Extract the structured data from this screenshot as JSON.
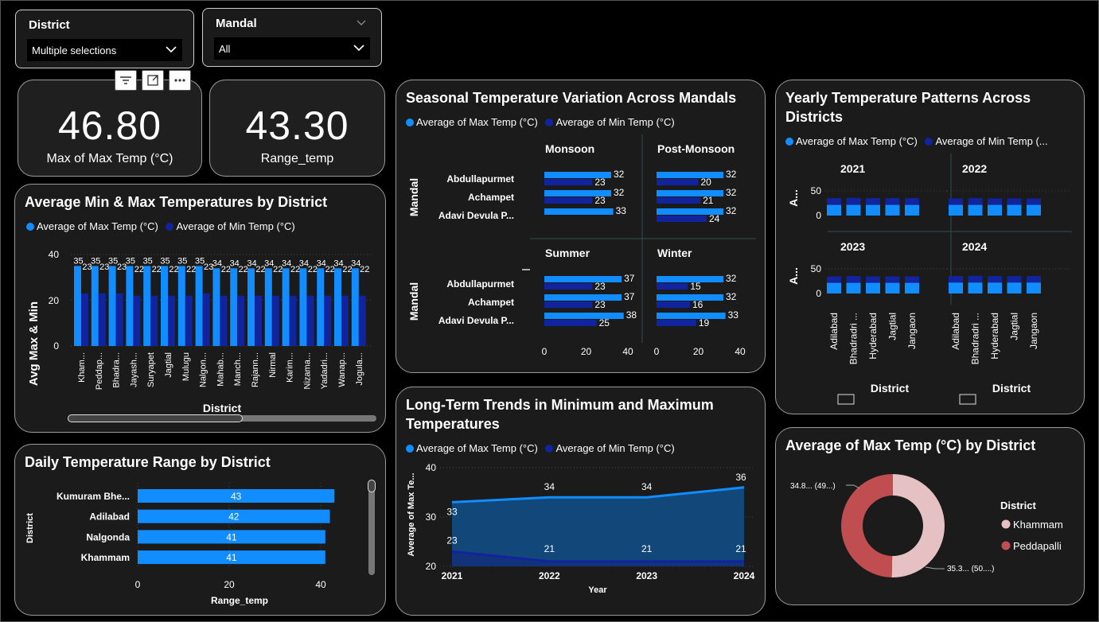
{
  "colors": {
    "max": "#118dff",
    "min": "#12239e",
    "card_bg": "#1b1b1b",
    "pie_khammam": "#e5c1c3",
    "pie_peddapalli": "#c04e50"
  },
  "slicers": {
    "district": {
      "title": "District",
      "value": "Multiple selections"
    },
    "mandal": {
      "title": "Mandal",
      "value": "All"
    }
  },
  "kpis": {
    "max_temp": {
      "value": "46.80",
      "label": "Max of Max Temp (°C)"
    },
    "range_temp": {
      "value": "43.30",
      "label": "Range_temp"
    }
  },
  "legend": {
    "max": "Average of Max Temp (°C)",
    "min": "Average of Min Temp (°C)",
    "min_truncated": "Average of Min Temp (..."
  },
  "avg_by_district": {
    "title": "Average Min & Max Temperatures by District",
    "ylabel": "Avg Max & Min",
    "xlabel": "District",
    "y_ticks": [
      "40",
      "20",
      "0"
    ]
  },
  "seasonal": {
    "title": "Seasonal Temperature Variation Across Mandals",
    "axis_label": "Mandal",
    "x_ticks": [
      "0",
      "20",
      "40"
    ]
  },
  "yearly": {
    "title_line1": "Yearly Temperature Patterns Across",
    "title_line2": "Districts",
    "axis_label": "A...",
    "xlabel": "District",
    "y_ticks": [
      "50",
      "0"
    ]
  },
  "daily_range": {
    "title": "Daily Temperature Range by District",
    "ylabel": "District",
    "xlabel": "Range_temp",
    "x_ticks": [
      "0",
      "20",
      "40"
    ]
  },
  "trends": {
    "title_line1": "Long-Term Trends in Minimum and Maximum",
    "title_line2": "Temperatures",
    "ylabel": "Average of Max Te...",
    "xlabel": "Year",
    "y_ticks": [
      "40",
      "30",
      "20"
    ]
  },
  "donut": {
    "title": "Average of Max Temp (°C) by District",
    "legend_title": "District",
    "label_peddapalli": "34.8... (49...)",
    "label_khammam": "35.3... (50....)"
  },
  "chart_data": [
    {
      "type": "bar",
      "title": "Average Min & Max Temperatures by District",
      "xlabel": "District",
      "ylabel": "Avg Max & Min",
      "ylim": [
        0,
        40
      ],
      "categories": [
        "Kham...",
        "Peddap...",
        "Bhadra...",
        "Jayash...",
        "Suryapet",
        "Jagtial",
        "Mulugu",
        "Nalgon...",
        "Mahab...",
        "Manch...",
        "Rajann...",
        "Nirmal",
        "Karim...",
        "Nizama...",
        "Yadadri...",
        "Wanap...",
        "Jogula..."
      ],
      "series": [
        {
          "name": "Average of Max Temp (°C)",
          "values": [
            35,
            35,
            35,
            35,
            35,
            35,
            35,
            35,
            34,
            34,
            34,
            34,
            34,
            34,
            34,
            34,
            34
          ]
        },
        {
          "name": "Average of Min Temp (°C)",
          "values": [
            23,
            23,
            23,
            22,
            22,
            22,
            22,
            23,
            22,
            22,
            22,
            22,
            22,
            22,
            22,
            22,
            22
          ]
        }
      ]
    },
    {
      "type": "bar",
      "title": "Seasonal Temperature Variation Across Mandals",
      "categories": [
        "Abdullapurmet",
        "Achampet",
        "Adavi Devula P..."
      ],
      "panels": [
        {
          "season": "Monsoon",
          "max": [
            32,
            32,
            33
          ],
          "min": [
            23,
            23,
            null
          ]
        },
        {
          "season": "Post-Monsoon",
          "max": [
            32,
            32,
            32
          ],
          "min": [
            20,
            21,
            24
          ]
        },
        {
          "season": "Summer",
          "max": [
            37,
            37,
            38
          ],
          "min": [
            23,
            23,
            25
          ]
        },
        {
          "season": "Winter",
          "max": [
            32,
            32,
            33
          ],
          "min": [
            15,
            16,
            19
          ]
        }
      ],
      "xlim": [
        0,
        40
      ]
    },
    {
      "type": "bar",
      "title": "Yearly Temperature Patterns Across Districts",
      "categories": [
        "Adilabad",
        "Bhadradri ...",
        "Hyderabad",
        "Jagtial",
        "Jangaon"
      ],
      "panels": [
        {
          "year": "2021",
          "max": [
            35,
            35,
            35,
            35,
            35
          ],
          "min": [
            22,
            23,
            22,
            22,
            22
          ]
        },
        {
          "year": "2022",
          "max": [
            35,
            35,
            35,
            35,
            35
          ],
          "min": [
            21,
            22,
            21,
            21,
            21
          ]
        },
        {
          "year": "2023",
          "max": [
            35,
            35,
            35,
            35,
            35
          ],
          "min": [
            21,
            22,
            21,
            21,
            21
          ]
        },
        {
          "year": "2024",
          "max": [
            36,
            36,
            36,
            36,
            36
          ],
          "min": [
            21,
            22,
            21,
            21,
            21
          ]
        }
      ],
      "ylim": [
        0,
        60
      ]
    },
    {
      "type": "bar",
      "title": "Daily Temperature Range by District",
      "categories": [
        "Kumuram Bhe...",
        "Adilabad",
        "Nalgonda",
        "Khammam"
      ],
      "values": [
        43,
        42,
        41,
        41
      ],
      "xlim": [
        0,
        46
      ]
    },
    {
      "type": "area",
      "title": "Long-Term Trends in Minimum and Maximum Temperatures",
      "x": [
        "2021",
        "2022",
        "2023",
        "2024"
      ],
      "series": [
        {
          "name": "Average of Max Temp (°C)",
          "values": [
            33,
            34,
            34,
            36
          ]
        },
        {
          "name": "Average of Min Temp (°C)",
          "values": [
            23,
            21,
            21,
            21
          ]
        }
      ],
      "ylim": [
        20,
        40
      ]
    },
    {
      "type": "pie",
      "title": "Average of Max Temp (°C) by District",
      "categories": [
        "Khammam",
        "Peddapalli"
      ],
      "values": [
        35.3,
        34.8
      ],
      "percent": [
        50,
        49
      ]
    }
  ]
}
